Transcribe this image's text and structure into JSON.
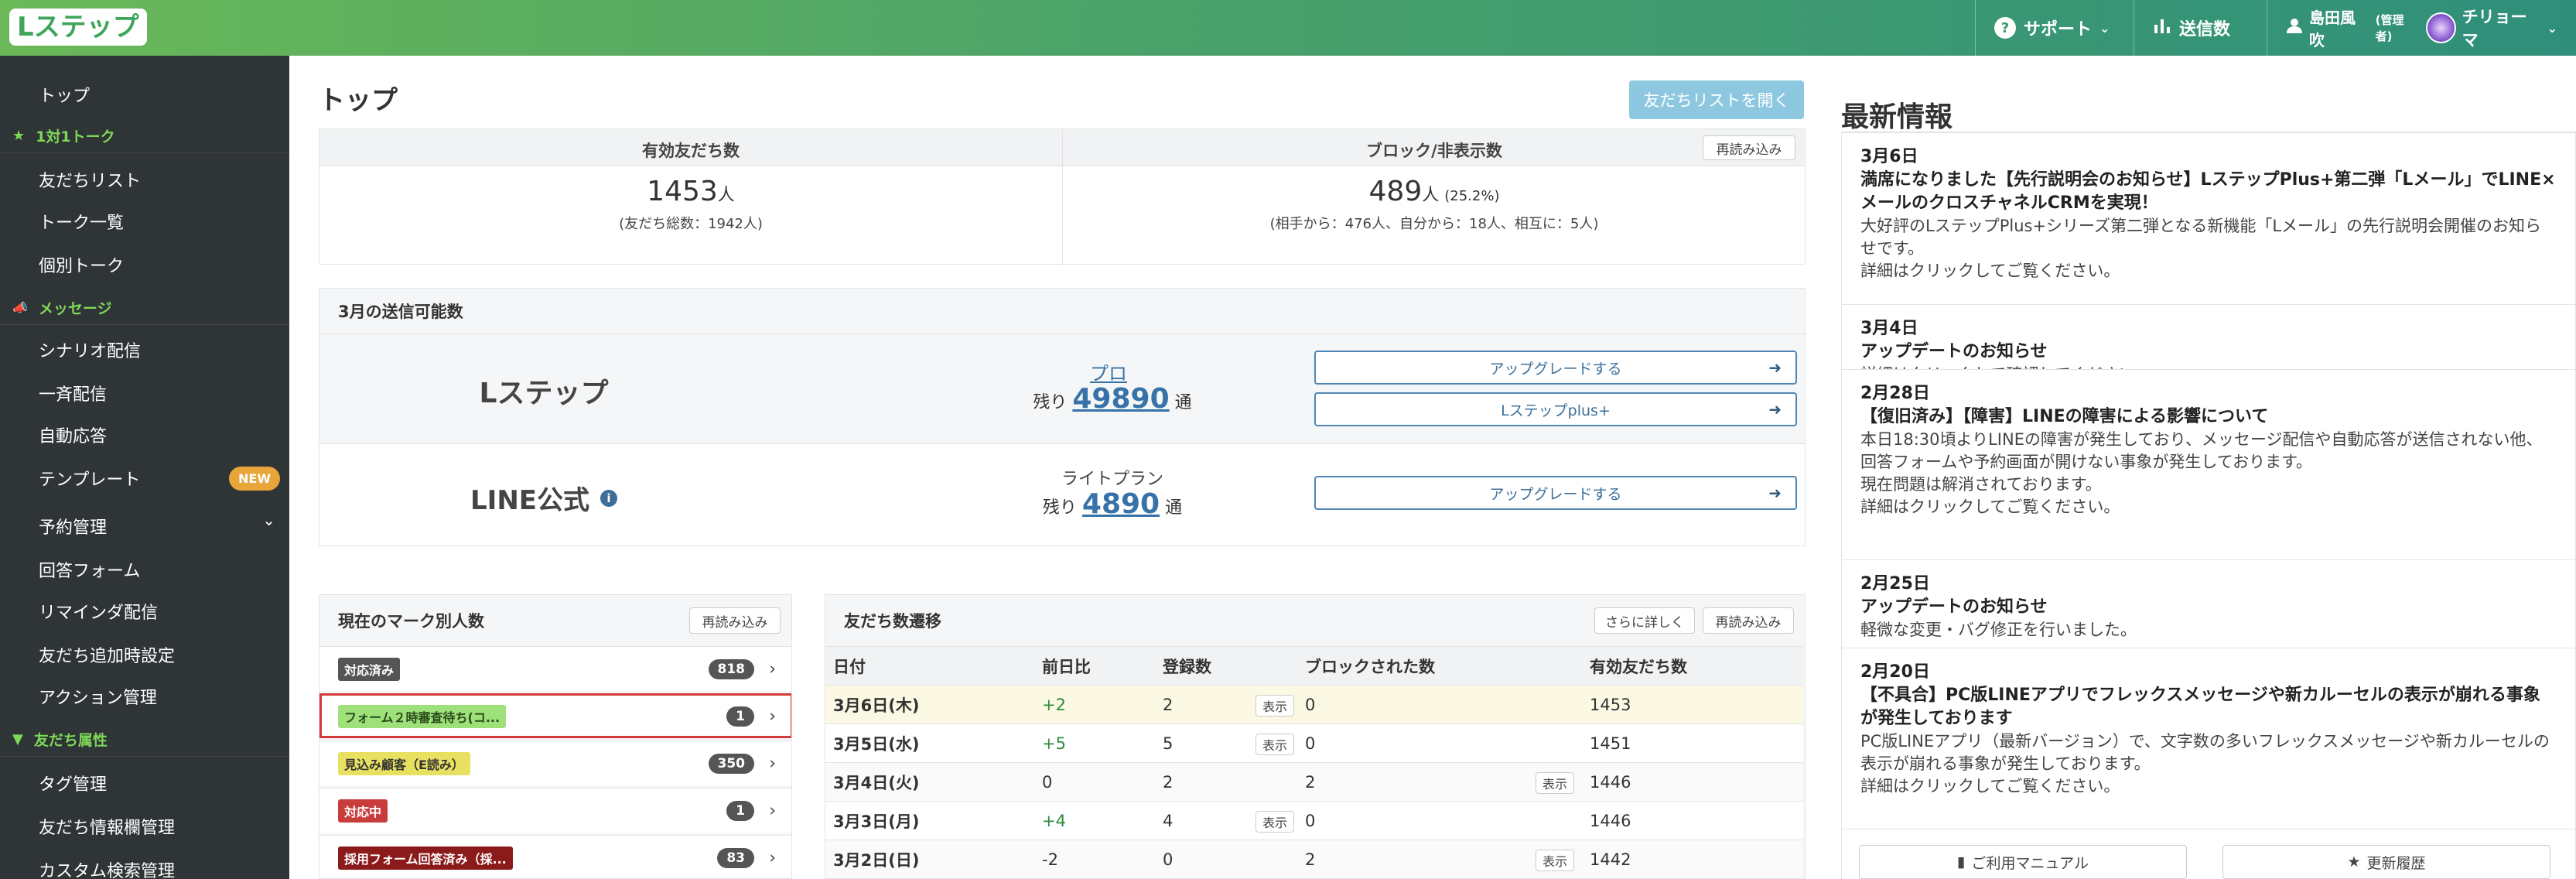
{
  "header": {
    "logo": "Lステップ",
    "support": "サポート",
    "send_count": "送信数",
    "user_name": "島田風吹",
    "user_role": "(管理者)",
    "account_name": "チリョーマ"
  },
  "sidebar": {
    "items": [
      {
        "label": "トップ",
        "type": "item"
      },
      {
        "label": "1対1トーク",
        "type": "section"
      },
      {
        "label": "友だちリスト",
        "type": "item"
      },
      {
        "label": "トーク一覧",
        "type": "item"
      },
      {
        "label": "個別トーク",
        "type": "item"
      },
      {
        "label": "メッセージ",
        "type": "section"
      },
      {
        "label": "シナリオ配信",
        "type": "item"
      },
      {
        "label": "一斉配信",
        "type": "item"
      },
      {
        "label": "自動応答",
        "type": "item"
      },
      {
        "label": "テンプレート",
        "type": "item",
        "badge": "NEW"
      },
      {
        "label": "予約管理",
        "type": "item"
      },
      {
        "label": "回答フォーム",
        "type": "item"
      },
      {
        "label": "リマインダ配信",
        "type": "item"
      },
      {
        "label": "友だち追加時設定",
        "type": "item"
      },
      {
        "label": "アクション管理",
        "type": "item"
      },
      {
        "label": "友だち属性",
        "type": "section"
      },
      {
        "label": "タグ管理",
        "type": "item"
      },
      {
        "label": "友だち情報欄管理",
        "type": "item"
      },
      {
        "label": "カスタム検索管理",
        "type": "item"
      }
    ]
  },
  "page": {
    "title": "トップ",
    "open_friends_button": "友だちリストを開く"
  },
  "stats": {
    "valid_label": "有効友だち数",
    "valid_value": "1453",
    "valid_unit": "人",
    "valid_sub": "(友だち総数：1942人)",
    "block_label": "ブロック/非表示数",
    "block_value": "489",
    "block_unit": "人",
    "block_pct": "(25.2%)",
    "block_sub": "(相手から：476人、自分から：18人、相互に：5人)",
    "reload": "再読み込み"
  },
  "send": {
    "title": "3月の送信可能数",
    "lstep_name": "Lステップ",
    "lstep_plan": "プロ",
    "lstep_remain_label": "残り",
    "lstep_remain": "49890",
    "lstep_unit": "通",
    "upgrade": "アップグレードする",
    "lstep_plus": "Lステップplus+",
    "line_name": "LINE公式",
    "line_plan": "ライトプラン",
    "line_remain_label": "残り",
    "line_remain": "4890",
    "line_unit": "通"
  },
  "marks": {
    "title": "現在のマーク別人数",
    "reload": "再読み込み",
    "rows": [
      {
        "label": "対応済み",
        "count": "818",
        "bg": "#555555",
        "fg": "#ffffff"
      },
      {
        "label": "フォーム２時審査待ち(コ...",
        "count": "1",
        "bg": "#9ee07a",
        "fg": "#2a4a1a"
      },
      {
        "label": "見込み顧客（E読み）",
        "count": "350",
        "bg": "#e8e060",
        "fg": "#333333"
      },
      {
        "label": "対応中",
        "count": "1",
        "bg": "#c83c3c",
        "fg": "#ffffff"
      },
      {
        "label": "採用フォーム回答済み（採...",
        "count": "83",
        "bg": "#8b1a1a",
        "fg": "#ffffff"
      }
    ]
  },
  "trend": {
    "title": "友だち数遷移",
    "more": "さらに詳しく",
    "reload": "再読み込み",
    "headers": [
      "日付",
      "前日比",
      "登録数",
      "ブロックされた数",
      "有効友だち数"
    ],
    "show_label": "表示",
    "rows": [
      {
        "date": "3月6日(木)",
        "diff": "+2",
        "reg": "2",
        "block": "0",
        "valid": "1453",
        "show_reg": true,
        "show_block": false,
        "hl": true
      },
      {
        "date": "3月5日(水)",
        "diff": "+5",
        "reg": "5",
        "block": "0",
        "valid": "1451",
        "show_reg": true,
        "show_block": false,
        "hl": false
      },
      {
        "date": "3月4日(火)",
        "diff": "0",
        "reg": "2",
        "block": "2",
        "valid": "1446",
        "show_reg": false,
        "show_block": true,
        "hl": false
      },
      {
        "date": "3月3日(月)",
        "diff": "+4",
        "reg": "4",
        "block": "0",
        "valid": "1446",
        "show_reg": true,
        "show_block": false,
        "hl": false
      },
      {
        "date": "3月2日(日)",
        "diff": "-2",
        "reg": "0",
        "block": "2",
        "valid": "1442",
        "show_reg": false,
        "show_block": true,
        "hl": false
      }
    ]
  },
  "news": {
    "title": "最新情報",
    "items": [
      {
        "date": "3月6日",
        "title": "満席になりました【先行説明会のお知らせ】LステップPlus+第二弾「Lメール」でLINE×メールのクロスチャネルCRMを実現！",
        "body": [
          "大好評のLステップPlus+シリーズ第二弾となる新機能「Lメール」の先行説明会開催のお知らせです。",
          "詳細はクリックしてご覧ください。"
        ]
      },
      {
        "date": "3月4日",
        "title": "アップデートのお知らせ",
        "body": [
          "詳細はクリックして確認してください。"
        ]
      },
      {
        "date": "2月28日",
        "title": "【復旧済み】【障害】LINEの障害による影響について",
        "body": [
          "本日18:30頃よりLINEの障害が発生しており、メッセージ配信や自動応答が送信されない他、回答フォームや予約画面が開けない事象が発生しております。",
          "現在問題は解消されております。",
          "詳細はクリックしてご覧ください。"
        ]
      },
      {
        "date": "2月25日",
        "title": "アップデートのお知らせ",
        "body": [
          "軽微な変更・バグ修正を行いました。"
        ]
      },
      {
        "date": "2月20日",
        "title": "【不具合】PC版LINEアプリでフレックスメッセージや新カルーセルの表示が崩れる事象が発生しております",
        "body": [
          "PC版LINEアプリ（最新バージョン）で、文字数の多いフレックスメッセージや新カルーセルの表示が崩れる事象が発生しております。",
          "詳細はクリックしてご覧ください。"
        ]
      }
    ],
    "manual_button": "ご利用マニュアル",
    "history_button": "更新履歴"
  }
}
